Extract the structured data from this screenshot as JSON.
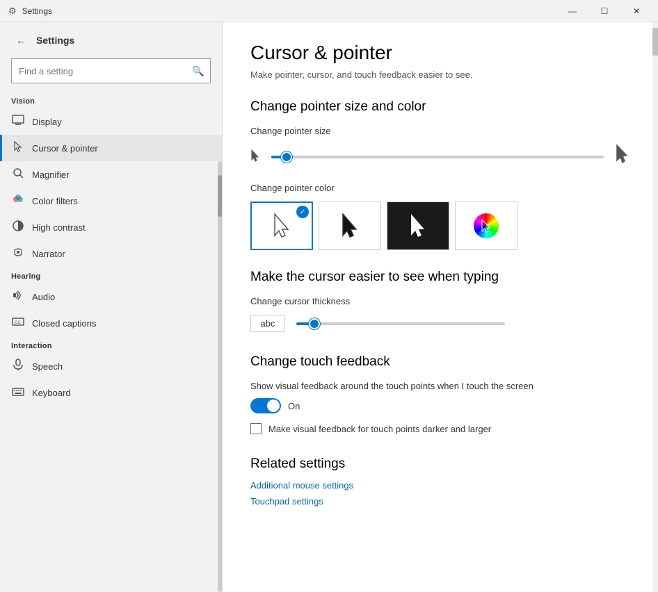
{
  "titlebar": {
    "icon": "⚙",
    "title": "Settings",
    "min_label": "—",
    "max_label": "☐",
    "close_label": "✕"
  },
  "sidebar": {
    "back_label": "←",
    "app_title": "Settings",
    "search_placeholder": "Find a setting",
    "section_vision": "Vision",
    "items_vision": [
      {
        "id": "display",
        "icon": "🖥",
        "label": "Display"
      },
      {
        "id": "cursor-pointer",
        "icon": "🖱",
        "label": "Cursor & pointer"
      },
      {
        "id": "magnifier",
        "icon": "🔍",
        "label": "Magnifier"
      },
      {
        "id": "color-filters",
        "icon": "🎨",
        "label": "Color filters"
      },
      {
        "id": "high-contrast",
        "icon": "✦",
        "label": "High contrast"
      },
      {
        "id": "narrator",
        "icon": "💬",
        "label": "Narrator"
      }
    ],
    "section_hearing": "Hearing",
    "items_hearing": [
      {
        "id": "audio",
        "icon": "🔊",
        "label": "Audio"
      },
      {
        "id": "closed-captions",
        "icon": "⬜",
        "label": "Closed captions"
      }
    ],
    "section_interaction": "Interaction",
    "items_interaction": [
      {
        "id": "speech",
        "icon": "🎤",
        "label": "Speech"
      },
      {
        "id": "keyboard",
        "icon": "⌨",
        "label": "Keyboard"
      }
    ]
  },
  "main": {
    "page_title": "Cursor & pointer",
    "page_subtitle": "Make pointer, cursor, and touch feedback easier to see.",
    "change_pointer_size_section": "Change pointer size and color",
    "pointer_size_label": "Change pointer size",
    "pointer_color_label": "Change pointer color",
    "cursor_section_title": "Make the cursor easier to see when typing",
    "cursor_thickness_label": "Change cursor thickness",
    "cursor_preview": "abc",
    "touch_section_title": "Change touch feedback",
    "touch_feedback_label": "Show visual feedback around the touch points when I touch the screen",
    "touch_toggle_state": "On",
    "touch_checkbox_label": "Make visual feedback for touch points darker and larger",
    "related_title": "Related settings",
    "related_links": [
      {
        "id": "mouse-settings",
        "label": "Additional mouse settings"
      },
      {
        "id": "touchpad-settings",
        "label": "Touchpad settings"
      }
    ]
  }
}
